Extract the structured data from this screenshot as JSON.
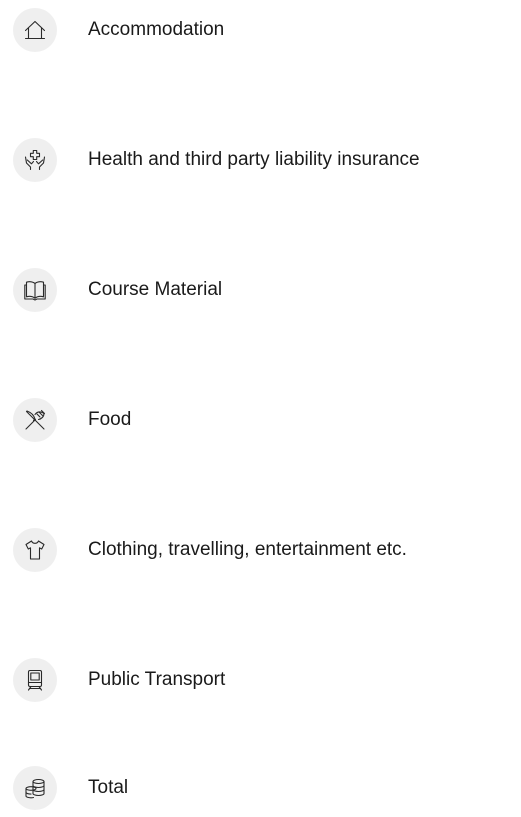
{
  "items": [
    {
      "label": "Accommodation",
      "icon": "house-icon"
    },
    {
      "label": "Health and third party liability insurance",
      "icon": "hands-medical-cross-icon"
    },
    {
      "label": "Course Material",
      "icon": "open-book-icon"
    },
    {
      "label": "Food",
      "icon": "fork-knife-icon"
    },
    {
      "label": "Clothing, travelling, entertainment etc.",
      "icon": "tshirt-icon"
    },
    {
      "label": "Public Transport",
      "icon": "train-icon"
    },
    {
      "label": "Total",
      "icon": "coin-stack-icon"
    }
  ],
  "colors": {
    "icon_background": "#efefef",
    "icon_stroke": "#2a2a2a",
    "text": "#1a1a1a"
  }
}
